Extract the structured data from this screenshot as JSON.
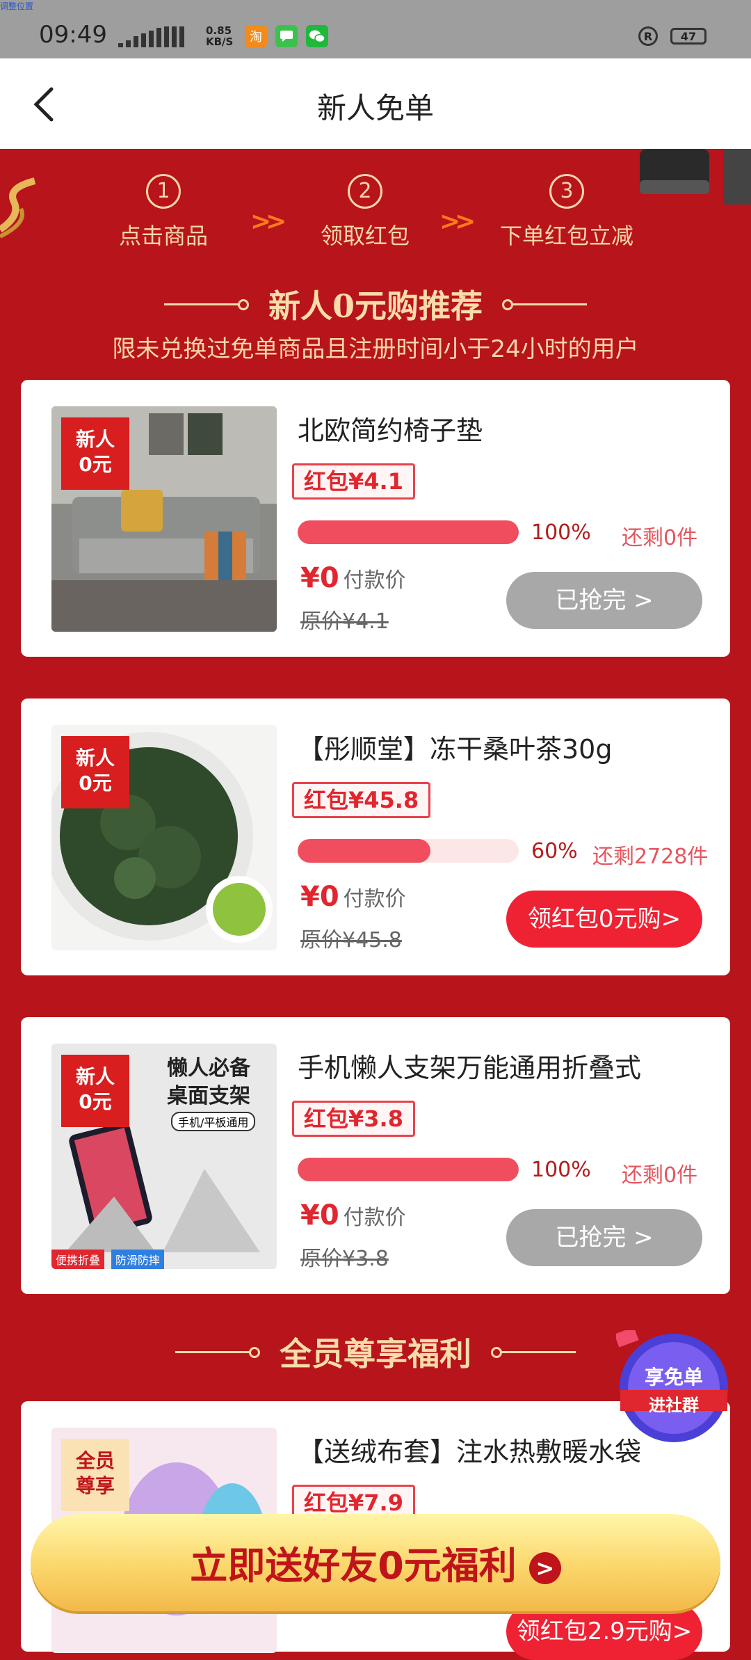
{
  "status_bar": {
    "tiny_text": "调整位置",
    "time": "09:49",
    "net_speed_top": "0.85",
    "net_speed_bottom": "KB/S",
    "apps": [
      "淘",
      "",
      ""
    ],
    "battery": "47",
    "r_symbol": "R"
  },
  "nav": {
    "title": "新人免单"
  },
  "steps": [
    {
      "num": "1",
      "label": "点击商品"
    },
    {
      "num": "2",
      "label": "领取红包"
    },
    {
      "num": "3",
      "label": "下单红包立减"
    }
  ],
  "arrow": ">>",
  "section1": {
    "title": "新人0元购推荐",
    "subtitle": "限未兑换过免单商品且注册时间小于24小时的用户"
  },
  "badge": {
    "line1": "新人",
    "line2": "0元"
  },
  "products": [
    {
      "name": "北欧简约椅子垫",
      "redpack": "红包¥4.1",
      "progress": 100,
      "pct_label": "100%",
      "remaining": "还剩0件",
      "price": "¥0",
      "price_label": "付款价",
      "original": "原价¥4.1",
      "button": "已抢完 >",
      "button_state": "sold_out"
    },
    {
      "name": "【彤顺堂】冻干桑叶茶30g",
      "redpack": "红包¥45.8",
      "progress": 60,
      "pct_label": "60%",
      "remaining": "还剩2728件",
      "price": "¥0",
      "price_label": "付款价",
      "original": "原价¥45.8",
      "button": "领红包0元购>",
      "button_state": "active"
    },
    {
      "name": "手机懒人支架万能通用折叠式",
      "redpack": "红包¥3.8",
      "progress": 100,
      "pct_label": "100%",
      "remaining": "还剩0件",
      "price": "¥0",
      "price_label": "付款价",
      "original": "原价¥3.8",
      "button": "已抢完 >",
      "button_state": "sold_out",
      "image_text": {
        "line1": "懒人必备",
        "line2": "桌面支架",
        "tag": "手机/平板通用",
        "corner1": "便携折叠",
        "corner2": "防滑防摔"
      }
    }
  ],
  "section2": {
    "title": "全员尊享福利"
  },
  "product4": {
    "name": "【送绒布套】注水热敷暖水袋",
    "redpack": "红包¥7.9",
    "badge_line1": "全员",
    "badge_line2": "尊享",
    "button_partial": "领红包2.9元购>"
  },
  "floating": {
    "line1": "享免单",
    "line2": "进社群"
  },
  "cta": {
    "label": "立即送好友0元福利",
    "go": ">"
  },
  "colors": {
    "page_bg": "#b8141b",
    "gold": "#f6d7a7",
    "red": "#ee2233",
    "gray_button": "#a8a8a8"
  }
}
